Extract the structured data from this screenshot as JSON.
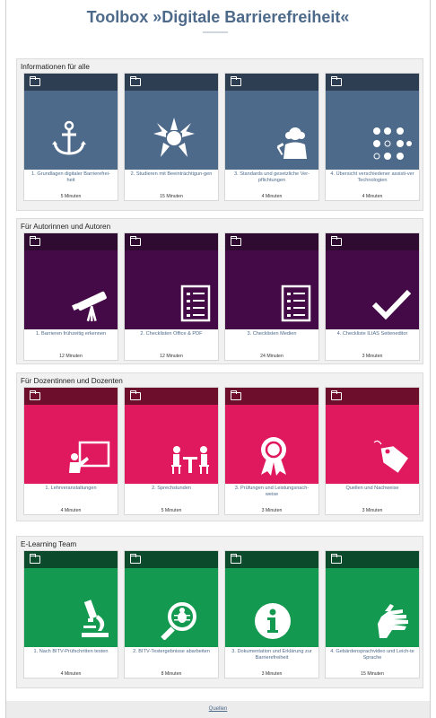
{
  "page": {
    "title": "Toolbox »Digitale Barrierefreiheit«"
  },
  "colors": {
    "section1_top": "#2e3e52",
    "section1_img": "#4d6a8a",
    "section2_top": "#2f0a31",
    "section2_img": "#440a47",
    "section3_top": "#6d0f2c",
    "section3_img": "#e0185d",
    "section4_top": "#0b4a2a",
    "section4_img": "#139a50"
  },
  "sections": [
    {
      "title": "Informationen für alle",
      "cards": [
        {
          "label": "1. Grundlagen digitaler Barrierefrei-heit",
          "duration": "5 Minuten",
          "icon": "anchor-icon"
        },
        {
          "label": "2. Studieren mit Beeinträchtigun-gen",
          "duration": "15 Minuten",
          "icon": "hands-circle-icon"
        },
        {
          "label": "3. Standards und gesetzliche Ver-pflichtungen",
          "duration": "4 Minuten",
          "icon": "judge-icon"
        },
        {
          "label": "4. Übersicht verschiedener assisti-ver Technologien",
          "duration": "4 Minuten",
          "icon": "braille-icon"
        }
      ]
    },
    {
      "title": "Für Autorinnen und Autoren",
      "cards": [
        {
          "label": "1. Barrieren frühzeitig erkennen",
          "duration": "12 Minuten",
          "icon": "telescope-icon"
        },
        {
          "label": "2. Checklisten Office & PDF",
          "duration": "12 Minuten",
          "icon": "checklist-icon"
        },
        {
          "label": "3. Checklisten Medien",
          "duration": "24 Minuten",
          "icon": "checklist-icon"
        },
        {
          "label": "4. Checkliste ILIAS Seiteneditor",
          "duration": "3 Minuten",
          "icon": "checkmark-icon"
        }
      ]
    },
    {
      "title": "Für Dozentinnen und Dozenten",
      "cards": [
        {
          "label": "1. Lehrveranstaltungen",
          "duration": "4 Minuten",
          "icon": "presentation-icon"
        },
        {
          "label": "2. Sprechstunden",
          "duration": "5 Minuten",
          "icon": "meeting-icon"
        },
        {
          "label": "3. Prüfungen und Leistungsnach-weise",
          "duration": "3 Minuten",
          "icon": "award-icon"
        },
        {
          "label": "Quellen und Nachweise",
          "duration": "3 Minuten",
          "icon": "tag-icon"
        }
      ]
    },
    {
      "title": "E-Learning Team",
      "cards": [
        {
          "label": "1. Nach BITV-Prüfschritten testen",
          "duration": "4 Minuten",
          "icon": "microscope-icon"
        },
        {
          "label": "2. BITV-Testergebnisse abarbeiten",
          "duration": "8 Minuten",
          "icon": "bug-search-icon"
        },
        {
          "label": "3. Dokumentation und Erklärung zur Barrierefreiheit",
          "duration": "3 Minuten",
          "icon": "info-icon"
        },
        {
          "label": "4. Gebärdensprachvideo und Leich-te Sprache",
          "duration": "15 Minuten",
          "icon": "sign-language-icon"
        }
      ]
    }
  ],
  "footer": {
    "link": "Quellen"
  }
}
